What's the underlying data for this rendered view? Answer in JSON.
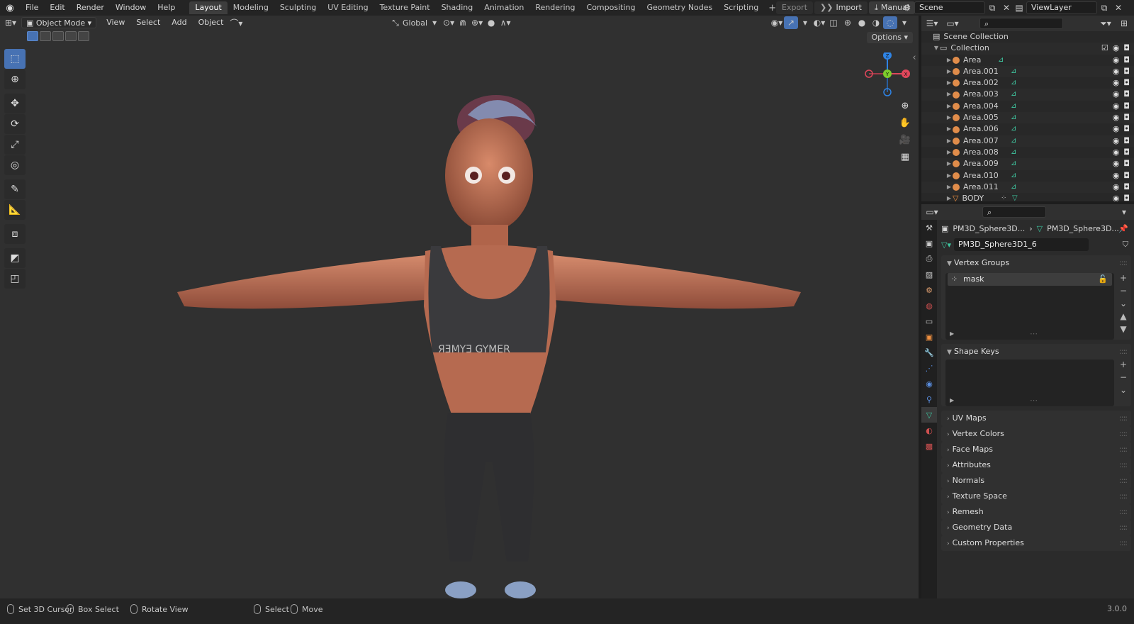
{
  "topbar": {
    "menus": [
      "File",
      "Edit",
      "Render",
      "Window",
      "Help"
    ],
    "workspaces": [
      "Layout",
      "Modeling",
      "Sculpting",
      "UV Editing",
      "Texture Paint",
      "Shading",
      "Animation",
      "Rendering",
      "Compositing",
      "Geometry Nodes",
      "Scripting"
    ],
    "active_workspace": "Layout",
    "add_label": "+",
    "export_label": "Export",
    "import_label": "Import",
    "manual_label": "Manual",
    "scene_name": "Scene",
    "view_layer": "ViewLayer"
  },
  "viewport_header": {
    "mode": "Object Mode",
    "menus": [
      "View",
      "Select",
      "Add",
      "Object"
    ],
    "orientation": "Global",
    "options_label": "Options"
  },
  "gizmo": {
    "x": "X",
    "y": "Y",
    "z": "Z"
  },
  "outliner": {
    "scene_collection": "Scene Collection",
    "collection": "Collection",
    "items": [
      "Area",
      "Area.001",
      "Area.002",
      "Area.003",
      "Area.004",
      "Area.005",
      "Area.006",
      "Area.007",
      "Area.008",
      "Area.009",
      "Area.010",
      "Area.011",
      "BODY"
    ]
  },
  "properties": {
    "breadcrumb_object": "PM3D_Sphere3D...",
    "breadcrumb_mesh": "PM3D_Sphere3D...",
    "mesh_name": "PM3D_Sphere3D1_6",
    "vertex_groups_title": "Vertex Groups",
    "vertex_group_item": "mask",
    "shape_keys_title": "Shape Keys",
    "collapsed_panels": [
      "UV Maps",
      "Vertex Colors",
      "Face Maps",
      "Attributes",
      "Normals",
      "Texture Space",
      "Remesh",
      "Geometry Data",
      "Custom Properties"
    ]
  },
  "status": {
    "set_cursor": "Set 3D Cursor",
    "box_select": "Box Select",
    "rotate_view": "Rotate View",
    "select": "Select",
    "move": "Move",
    "version": "3.0.0"
  },
  "colors": {
    "accent": "#4772b3",
    "light_icon": "#3ec7a0",
    "lamp": "#e08c4a"
  }
}
